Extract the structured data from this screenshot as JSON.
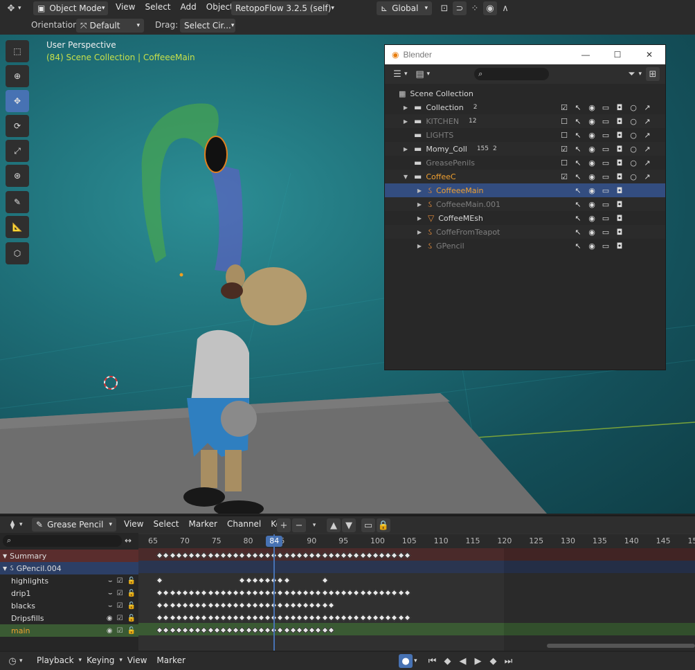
{
  "topbar": {
    "mode": "Object Mode",
    "menus": [
      "View",
      "Select",
      "Add",
      "Object"
    ],
    "addon": "RetopoFlow 3.2.5 (self)",
    "transform_orientation": "Global"
  },
  "toolheader": {
    "orientation_label": "Orientation:",
    "orientation_value": "Default",
    "drag_label": "Drag:",
    "drag_value": "Select Cir..."
  },
  "viewport": {
    "perspective": "User Perspective",
    "context": "(84) Scene Collection | CoffeeeMain"
  },
  "outliner_window": {
    "title": "Blender",
    "search_placeholder": "",
    "root": "Scene Collection",
    "rows": [
      {
        "label": "Collection",
        "kind": "collection",
        "level": 0,
        "expand": "closed",
        "checked": true,
        "dim": false,
        "badges": [
          "2"
        ]
      },
      {
        "label": "KITCHEN",
        "kind": "collection",
        "level": 0,
        "expand": "closed",
        "checked": false,
        "dim": true,
        "badges": [
          "12"
        ]
      },
      {
        "label": "LIGHTS",
        "kind": "collection",
        "level": 0,
        "expand": "",
        "checked": false,
        "dim": true,
        "badges": []
      },
      {
        "label": "Momy_Coll",
        "kind": "collection",
        "level": 0,
        "expand": "closed",
        "checked": true,
        "dim": false,
        "badges": [
          "155",
          "2"
        ]
      },
      {
        "label": "GreasePenils",
        "kind": "collection",
        "level": 0,
        "expand": "",
        "checked": false,
        "dim": true,
        "badges": []
      },
      {
        "label": "CoffeeC",
        "kind": "collection",
        "level": 0,
        "expand": "open",
        "checked": true,
        "dim": false,
        "badges": []
      },
      {
        "label": "CoffeeeMain",
        "kind": "gpencil",
        "level": 1,
        "expand": "closed",
        "selected": true,
        "dim": false,
        "badges": []
      },
      {
        "label": "CoffeeeMain.001",
        "kind": "gpencil",
        "level": 1,
        "expand": "closed",
        "dim": true,
        "badges": []
      },
      {
        "label": "CoffeeMEsh",
        "kind": "mesh",
        "level": 1,
        "expand": "closed",
        "dim": false,
        "badges": []
      },
      {
        "label": "CoffeFromTeapot",
        "kind": "gpencil",
        "level": 1,
        "expand": "closed",
        "dim": true,
        "badges": []
      },
      {
        "label": "GPencil",
        "kind": "gpencil",
        "level": 1,
        "expand": "closed",
        "dim": true,
        "badges": []
      }
    ]
  },
  "dopesheet": {
    "mode": "Grease Pencil",
    "menus": [
      "View",
      "Select",
      "Marker",
      "Channel",
      "Key"
    ],
    "current_frame": "84",
    "ruler": [
      "65",
      "70",
      "75",
      "80",
      "85",
      "90",
      "95",
      "100",
      "105",
      "110",
      "115",
      "120",
      "125",
      "130",
      "135",
      "140",
      "145",
      "15"
    ],
    "summary": "Summary",
    "object": "GPencil.004",
    "layers": [
      {
        "name": "highlights",
        "visible": false,
        "active": false
      },
      {
        "name": "drip1",
        "visible": false,
        "active": false
      },
      {
        "name": "blacks",
        "visible": false,
        "active": false
      },
      {
        "name": "Dripsfills",
        "visible": true,
        "active": false
      },
      {
        "name": "main",
        "visible": true,
        "active": true
      }
    ],
    "keys": {
      "summary": {
        "from": 66,
        "to": 105
      },
      "highlights": [
        66,
        79,
        80,
        81,
        82,
        83,
        84,
        85,
        86,
        92
      ],
      "drip1": {
        "from": 66,
        "to": 105
      },
      "blacks": {
        "from": 66,
        "to": 93
      },
      "Dripsfills": {
        "from": 66,
        "to": 105
      },
      "main": {
        "from": 66,
        "to": 93
      }
    },
    "colors": {
      "summary_row": "#5a2d2d",
      "object_row": "#2c3f66",
      "active_row": "#3a5a33",
      "playhead": "#4772b3"
    }
  },
  "timeline": {
    "menus": [
      "Playback",
      "Keying",
      "View",
      "Marker"
    ]
  }
}
